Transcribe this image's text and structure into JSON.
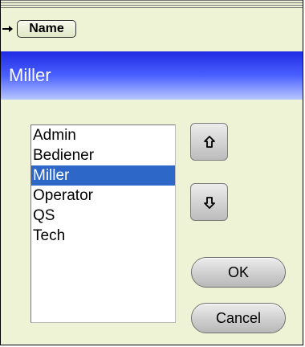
{
  "header": {
    "name_label": "Name",
    "selected_value": "Miller"
  },
  "users": [
    "Admin",
    "Bediener",
    "Miller",
    "Operator",
    "QS",
    "Tech"
  ],
  "buttons": {
    "ok": "OK",
    "cancel": "Cancel"
  },
  "icons": {
    "arrow": "right-arrow-icon",
    "up": "up-arrow-icon",
    "down": "down-arrow-icon"
  }
}
